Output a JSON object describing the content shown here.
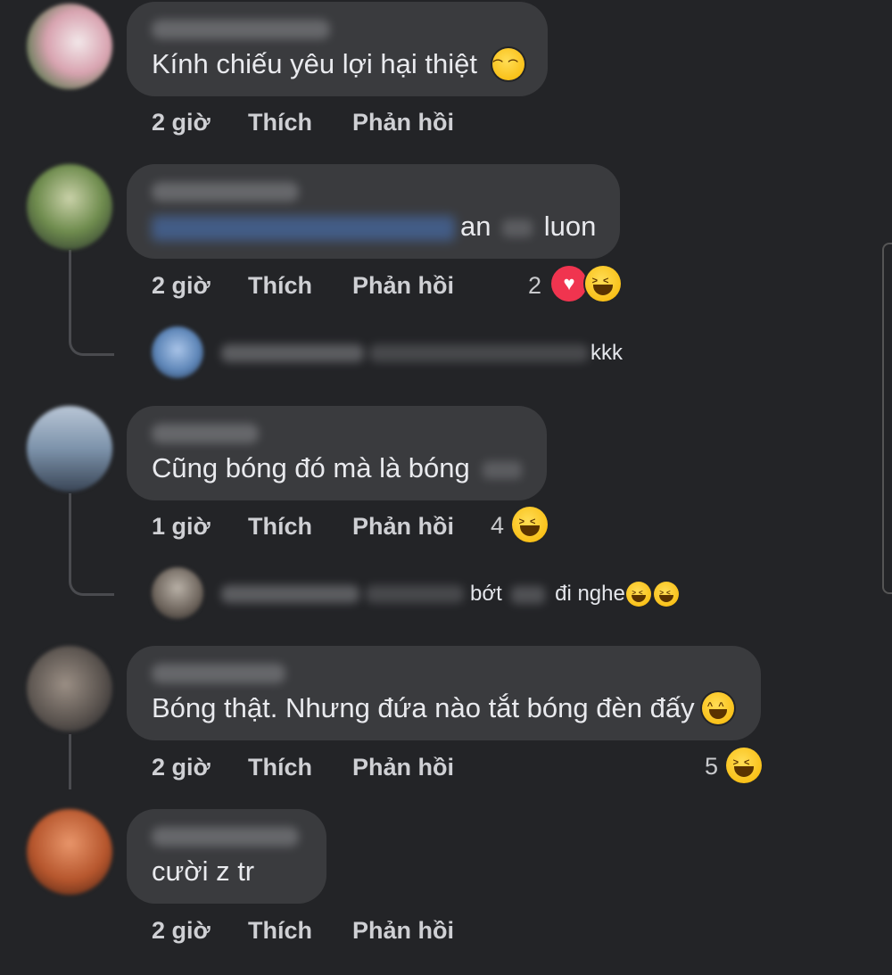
{
  "actions": {
    "like": "Thích",
    "reply": "Phản hồi"
  },
  "comments": [
    {
      "time": "2 giờ",
      "text": "Kính chiếu yêu lợi hại thiệt",
      "emoji": "relieved-face-emoji"
    },
    {
      "time": "2 giờ",
      "text_parts": [
        "an",
        "luon"
      ],
      "reaction_count": "2",
      "reactions": [
        "heart-reaction",
        "laughing-reaction"
      ],
      "reply": {
        "text": "kkk"
      }
    },
    {
      "time": "1 giờ",
      "text": "Cũng bóng đó mà là bóng",
      "reaction_count": "4",
      "reactions": [
        "laughing-reaction"
      ],
      "reply": {
        "text_parts": [
          "bớt",
          "đi nghe"
        ],
        "emoji": "laughing-emoji"
      }
    },
    {
      "time": "2 giờ",
      "text": "Bóng thật. Nhưng đứa nào tắt bóng đèn đấy",
      "emoji": "grinning-face-emoji",
      "reaction_count": "5",
      "reactions": [
        "laughing-reaction"
      ]
    },
    {
      "time": "2 giờ",
      "text": "cười z tr"
    }
  ],
  "colors": {
    "background": "#232427",
    "bubble": "#3a3b3e",
    "meta_text": "#cfd0d4"
  }
}
